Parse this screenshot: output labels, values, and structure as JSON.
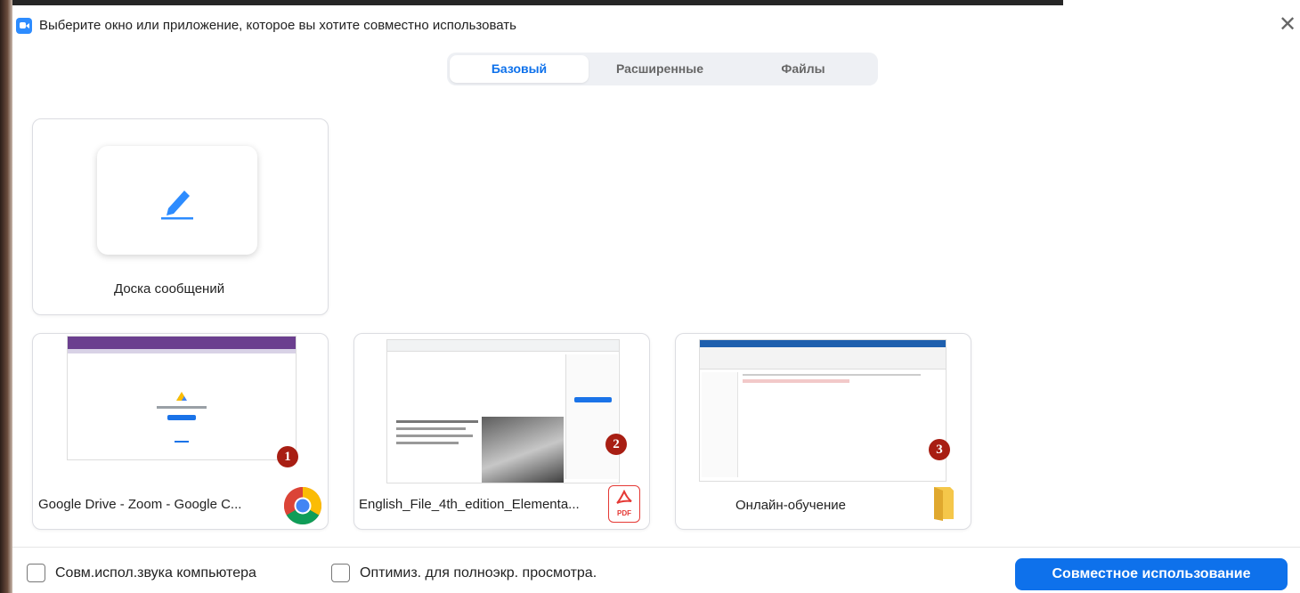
{
  "window": {
    "title": "Выберите окно или приложение, которое вы хотите совместно использовать",
    "close_glyph": "✕"
  },
  "tabs": [
    {
      "label": "Базовый",
      "active": true
    },
    {
      "label": "Расширенные",
      "active": false
    },
    {
      "label": "Файлы",
      "active": false
    }
  ],
  "whiteboard": {
    "label": "Доска сообщений",
    "icon": "pencil-icon"
  },
  "windows": [
    {
      "label": "Google Drive - Zoom - Google C...",
      "app_icon": "chrome-icon",
      "badge": "1"
    },
    {
      "label": "English_File_4th_edition_Elementa...",
      "app_icon": "pdf-icon",
      "badge": "2"
    },
    {
      "label": "Онлайн-обучение",
      "app_icon": "folder-icon",
      "badge": "3"
    }
  ],
  "pdf_icon_text": "PDF",
  "footer": {
    "share_sound_label": "Совм.испол.звука компьютера",
    "optimize_label": "Оптимиз. для полноэкр. просмотра.",
    "share_button": "Совместное использование"
  },
  "colors": {
    "accent": "#0e71eb",
    "badge": "#a81e13",
    "pdf_red": "#e53935",
    "folder": "#f5c74a"
  }
}
